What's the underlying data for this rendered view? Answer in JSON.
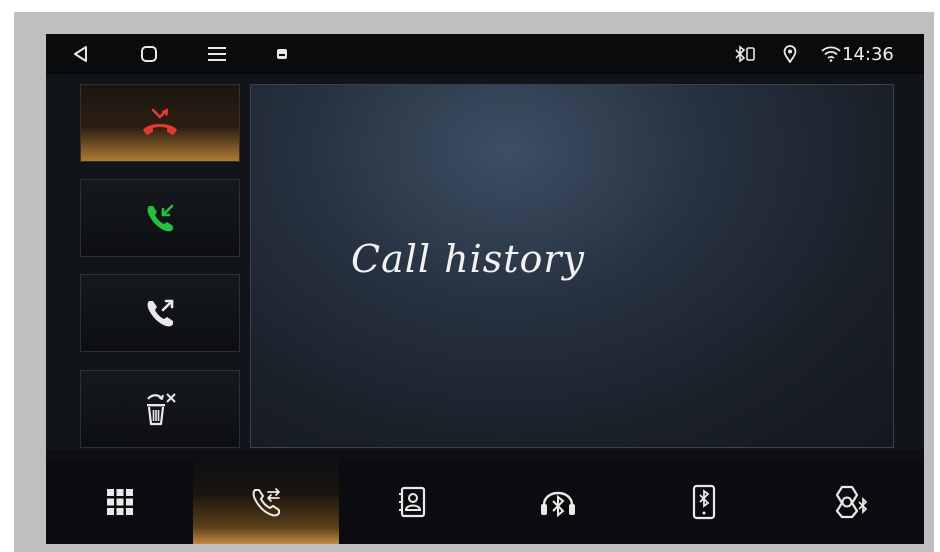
{
  "status_bar": {
    "time": "14:36",
    "icons": [
      "back-icon",
      "home-icon",
      "menu-icon",
      "notification-icon",
      "bluetooth-phone-icon",
      "location-icon",
      "wifi-icon"
    ]
  },
  "call_panel": {
    "title": "Call history"
  },
  "side_buttons": [
    {
      "name": "missed-calls",
      "icon": "missed-call-icon",
      "color": "#e23a2f",
      "active": true
    },
    {
      "name": "received-calls",
      "icon": "incoming-call-icon",
      "color": "#22c23d",
      "active": false
    },
    {
      "name": "dialed-calls",
      "icon": "outgoing-call-icon",
      "color": "#e9e9e9",
      "active": false
    },
    {
      "name": "delete-history",
      "icon": "trash-icon",
      "color": "#e9e9e9",
      "active": false
    }
  ],
  "bottom_tabs": [
    {
      "name": "tab-dialpad",
      "icon": "grid-icon",
      "active": false
    },
    {
      "name": "tab-call-log",
      "icon": "call-transfer-icon",
      "active": true
    },
    {
      "name": "tab-contacts",
      "icon": "contacts-icon",
      "active": false
    },
    {
      "name": "tab-bt-music",
      "icon": "bluetooth-headphones-icon",
      "active": false
    },
    {
      "name": "tab-bt-devices",
      "icon": "bluetooth-phone-icon",
      "active": false
    },
    {
      "name": "tab-bt-settings",
      "icon": "bluetooth-settings-icon",
      "active": false
    }
  ],
  "colors": {
    "accent_amber": "#c08a3f",
    "missed_red": "#e23a2f",
    "answer_green": "#22c23d"
  }
}
